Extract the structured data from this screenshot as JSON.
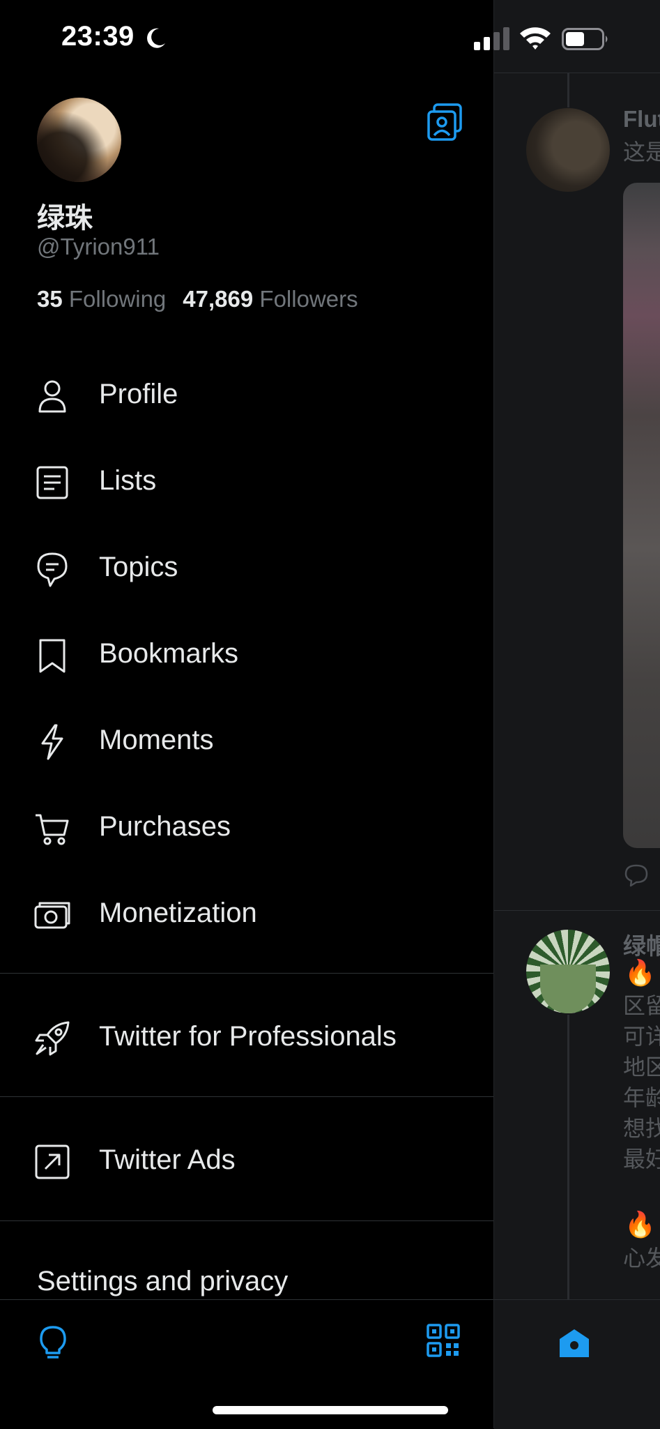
{
  "status_bar": {
    "time": "23:39"
  },
  "profile": {
    "display_name": "绿珠",
    "handle": "@Tyrion911",
    "following_count": "35",
    "following_label": "Following",
    "followers_count": "47,869",
    "followers_label": "Followers"
  },
  "menu": {
    "items": [
      {
        "label": "Profile",
        "icon": "person-icon"
      },
      {
        "label": "Lists",
        "icon": "list-icon"
      },
      {
        "label": "Topics",
        "icon": "topics-icon"
      },
      {
        "label": "Bookmarks",
        "icon": "bookmark-icon"
      },
      {
        "label": "Moments",
        "icon": "lightning-icon"
      },
      {
        "label": "Purchases",
        "icon": "cart-icon"
      },
      {
        "label": "Monetization",
        "icon": "money-icon"
      }
    ],
    "professionals_label": "Twitter for Professionals",
    "ads_label": "Twitter Ads",
    "settings_label": "Settings and privacy"
  },
  "timeline": {
    "tweet1_name": "Flut",
    "tweet1_text": "这是",
    "tweet2_name": "绿帽",
    "tweet2_lines": [
      "区留",
      "可详",
      "地区",
      "年龄",
      "想找",
      "最好"
    ],
    "tweet2_tail": "心发"
  },
  "colors": {
    "accent": "#1d9bf0",
    "background": "#000000",
    "secondary_text": "#71767b"
  }
}
